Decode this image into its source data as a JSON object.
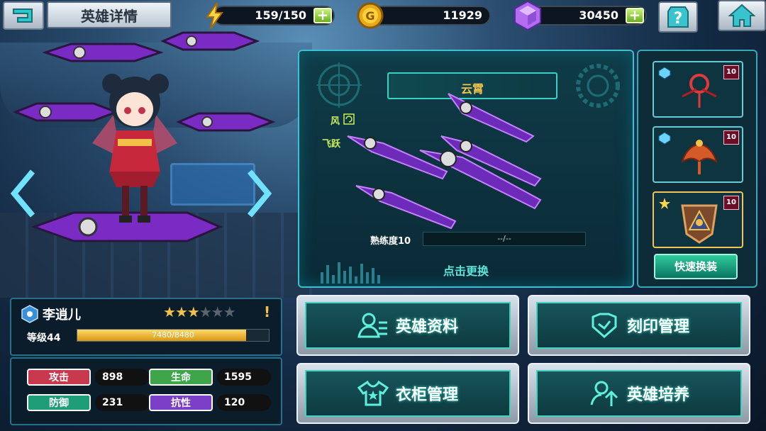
{
  "header": {
    "title": "英雄详情"
  },
  "resources": {
    "energy": {
      "value": "159/150",
      "icon": "lightning-icon",
      "plus": "+"
    },
    "gold": {
      "value": "11929",
      "icon": "gold-coin-icon",
      "plus": "+"
    },
    "gem": {
      "value": "30450",
      "icon": "gem-icon",
      "plus": "+"
    }
  },
  "buttons": {
    "back": "back-icon",
    "help": "help-icon",
    "home": "home-icon"
  },
  "weapon": {
    "name": "云霄",
    "tags": [
      "风",
      "飞跃"
    ],
    "proficiency_label": "熟练度10",
    "proficiency_value": "--/--",
    "change_label": "点击更换"
  },
  "equipment": {
    "slots": [
      {
        "level": "10",
        "item": "red-pendant-icon",
        "mark": "blue-gem-icon"
      },
      {
        "level": "10",
        "item": "phoenix-icon",
        "mark": "blue-gem-icon"
      },
      {
        "level": "10",
        "item": "badge-icon",
        "mark": "star-icon"
      }
    ],
    "quick_equip": "快速换装"
  },
  "hero": {
    "name": "李逍儿",
    "stars_filled": 3,
    "stars_total": 6,
    "alert": "!",
    "level_label": "等级44",
    "xp_text": "7480/8480",
    "xp_fraction": 0.882
  },
  "stats": [
    {
      "label": "攻击",
      "value": "898",
      "color": "#c9394e"
    },
    {
      "label": "生命",
      "value": "1595",
      "color": "#3fa54a"
    },
    {
      "label": "防御",
      "value": "231",
      "color": "#1f9c78"
    },
    {
      "label": "抗性",
      "value": "120",
      "color": "#7b3fc6"
    }
  ],
  "menu": [
    {
      "label": "英雄资料",
      "icon": "profile-icon"
    },
    {
      "label": "刻印管理",
      "icon": "engrave-icon"
    },
    {
      "label": "衣柜管理",
      "icon": "wardrobe-icon"
    },
    {
      "label": "英雄培养",
      "icon": "upgrade-icon"
    }
  ]
}
